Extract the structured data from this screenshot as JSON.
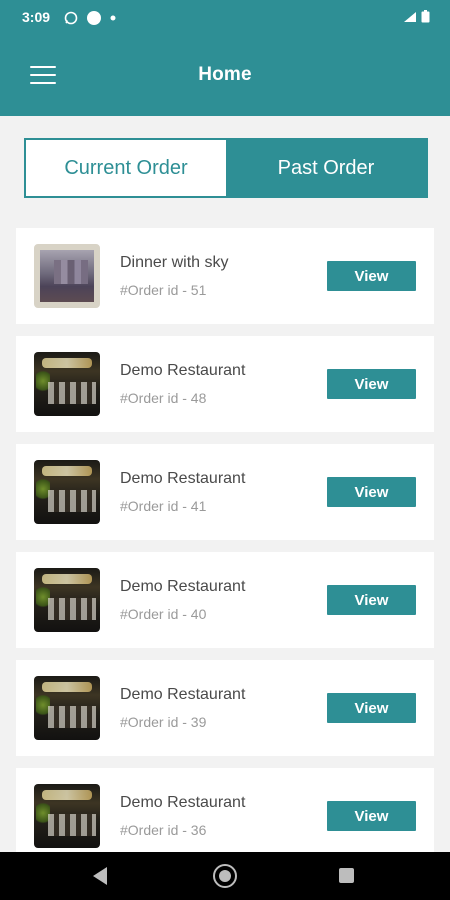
{
  "status_bar": {
    "time": "3:09",
    "icons": [
      "whatsapp-icon",
      "circle-notification-icon",
      "dot-icon",
      "signal-icon",
      "battery-icon"
    ]
  },
  "app_bar": {
    "title": "Home",
    "menu_icon": "hamburger-menu-icon",
    "background": "#2e8f95"
  },
  "tabs": [
    {
      "label": "Current Order",
      "active": false
    },
    {
      "label": "Past Order",
      "active": true
    }
  ],
  "orders": [
    {
      "name": "Dinner with sky",
      "order_id": "#Order id - 51",
      "button": "View",
      "thumbnail": "sky-building-image"
    },
    {
      "name": "Demo Restaurant",
      "order_id": "#Order id - 48",
      "button": "View",
      "thumbnail": "restaurant-interior-image"
    },
    {
      "name": "Demo Restaurant",
      "order_id": "#Order id - 41",
      "button": "View",
      "thumbnail": "restaurant-interior-image"
    },
    {
      "name": "Demo Restaurant",
      "order_id": "#Order id - 40",
      "button": "View",
      "thumbnail": "restaurant-interior-image"
    },
    {
      "name": "Demo Restaurant",
      "order_id": "#Order id - 39",
      "button": "View",
      "thumbnail": "restaurant-interior-image"
    },
    {
      "name": "Demo Restaurant",
      "order_id": "#Order id - 36",
      "button": "View",
      "thumbnail": "restaurant-interior-image"
    }
  ],
  "nav_bar": {
    "icons": [
      "back-icon",
      "home-icon",
      "recents-icon"
    ]
  },
  "colors": {
    "accent": "#2e8f95",
    "background": "#f2f2f2"
  }
}
